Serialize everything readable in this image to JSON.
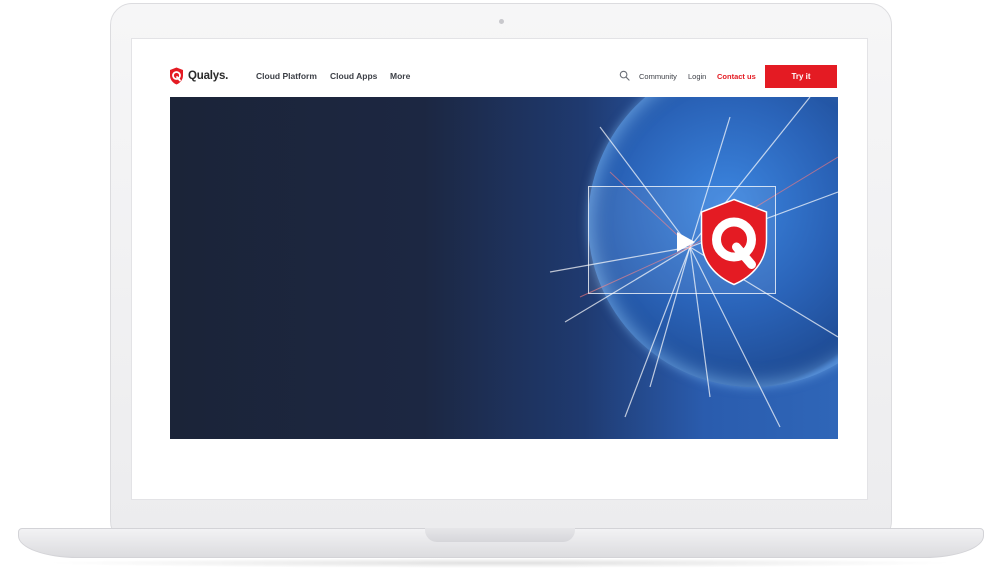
{
  "brand": {
    "name": "Qualys.",
    "accent_color": "#e41b23"
  },
  "nav": {
    "primary": [
      "Cloud Platform",
      "Cloud Apps",
      "More"
    ],
    "search_icon": "search-icon",
    "community": "Community",
    "login": "Login",
    "contact": "Contact us",
    "cta": "Try it"
  },
  "hero": {
    "type": "video",
    "play_icon": "play-icon",
    "logo_icon": "qualys-shield-icon"
  }
}
